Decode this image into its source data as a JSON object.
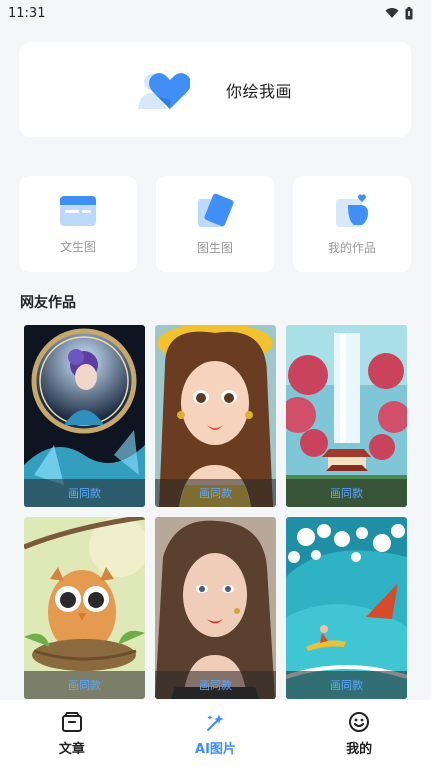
{
  "status_bar": {
    "time": "11:31",
    "icons": [
      "wifi-icon",
      "battery-icon"
    ]
  },
  "hero": {
    "title": "你绘我画",
    "icon": "heart-person-icon"
  },
  "tools": [
    {
      "label": "文生图",
      "icon": "text-image-icon"
    },
    {
      "label": "图生图",
      "icon": "image-image-icon"
    },
    {
      "label": "我的作品",
      "icon": "my-works-icon"
    }
  ],
  "section": {
    "title": "网友作品"
  },
  "works": [
    {
      "button": "画同款",
      "art": "fantasy-woman-mirror"
    },
    {
      "button": "画同款",
      "art": "cartoon-girl-yellow-hat"
    },
    {
      "button": "画同款",
      "art": "waterfall-temple-landscape"
    },
    {
      "button": "画同款",
      "art": "cartoon-owl-nest"
    },
    {
      "button": "画同款",
      "art": "realistic-woman-portrait"
    },
    {
      "button": "画同款",
      "art": "surfer-wave"
    }
  ],
  "tabbar": {
    "items": [
      {
        "label": "文章",
        "icon": "article-box-icon",
        "active": false
      },
      {
        "label": "AI图片",
        "icon": "ai-magic-icon",
        "active": true
      },
      {
        "label": "我的",
        "icon": "smiley-face-icon",
        "active": false
      }
    ]
  },
  "colors": {
    "accent": "#3b8cff",
    "background": "#f5f6f8"
  }
}
